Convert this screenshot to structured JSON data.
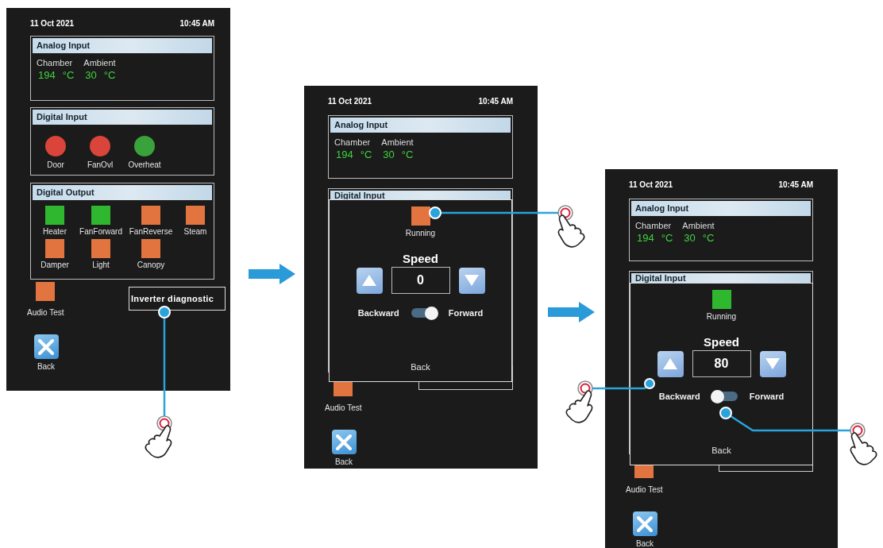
{
  "screens": [
    {
      "kind": "main",
      "date": "11 Oct 2021",
      "time": "10:45 AM",
      "analog_input": {
        "title": "Analog Input",
        "sensors": [
          {
            "label": "Chamber",
            "value": "194",
            "unit": "°C"
          },
          {
            "label": "Ambient",
            "value": "30",
            "unit": "°C"
          }
        ]
      },
      "digital_input": {
        "title": "Digital Input",
        "lamps": [
          {
            "label": "Door",
            "color": "#d9453a"
          },
          {
            "label": "FanOvl",
            "color": "#d9453a"
          },
          {
            "label": "Overheat",
            "color": "#3aa23a"
          }
        ]
      },
      "digital_output": {
        "title": "Digital Output",
        "outputs": [
          {
            "label": "Heater",
            "on": true
          },
          {
            "label": "FanForward",
            "on": true
          },
          {
            "label": "FanReverse",
            "on": false
          },
          {
            "label": "Steam",
            "on": false
          },
          {
            "label": "Damper",
            "on": false
          },
          {
            "label": "Light",
            "on": false
          },
          {
            "label": "Canopy",
            "on": false
          }
        ]
      },
      "audio_test": {
        "label": "Audio Test",
        "on": false
      },
      "inverter_button": "Inverter diagnostic",
      "back": "Back"
    },
    {
      "kind": "inverter",
      "date": "11 Oct 2021",
      "time": "10:45 AM",
      "analog_input": {
        "title": "Analog Input",
        "sensors": [
          {
            "label": "Chamber",
            "value": "194",
            "unit": "°C"
          },
          {
            "label": "Ambient",
            "value": "30",
            "unit": "°C"
          }
        ]
      },
      "digital_input": {
        "title": "Digital Input"
      },
      "popup": {
        "running": {
          "label": "Running",
          "on": false
        },
        "speed_title": "Speed",
        "speed": "0",
        "backward_label": "Backward",
        "forward_label": "Forward",
        "forward": true,
        "back": "Back"
      },
      "audio_test": {
        "label": "Audio Test",
        "on": false
      },
      "back": "Back"
    },
    {
      "kind": "inverter",
      "date": "11 Oct 2021",
      "time": "10:45 AM",
      "analog_input": {
        "title": "Analog Input",
        "sensors": [
          {
            "label": "Chamber",
            "value": "194",
            "unit": "°C"
          },
          {
            "label": "Ambient",
            "value": "30",
            "unit": "°C"
          }
        ]
      },
      "digital_input": {
        "title": "Digital Input"
      },
      "popup": {
        "running": {
          "label": "Running",
          "on": true
        },
        "speed_title": "Speed",
        "speed": "80",
        "backward_label": "Backward",
        "forward_label": "Forward",
        "forward": false,
        "back": "Back"
      },
      "audio_test": {
        "label": "Audio Test",
        "on": false
      },
      "back": "Back"
    }
  ]
}
